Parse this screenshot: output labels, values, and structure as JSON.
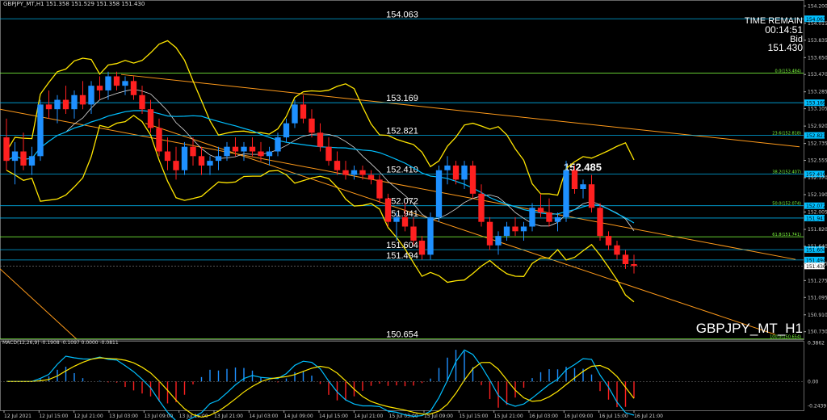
{
  "header": {
    "ohlc": "GBPJPY_MT,H1  151.358 151.529 151.358 151.430"
  },
  "time_remain": {
    "label": "TIME REMAIN",
    "value": "00:14:51",
    "bid_label": "Bid",
    "bid_value": "151.430"
  },
  "symbol_label": "GBPJPY_MT_H1",
  "colors": {
    "bull": "#1e90ff",
    "bear": "#ff2020",
    "level": "#7fff3f",
    "trend": "#ff9a1a",
    "band": "#ffe600",
    "cyan": "#00bfff"
  },
  "chart_data": {
    "type": "candlestick",
    "ylim": [
      150.65,
      154.22
    ],
    "price_ticks": [
      "154.200",
      "154.015",
      "153.835",
      "153.650",
      "153.470",
      "153.285",
      "153.105",
      "152.920",
      "152.735",
      "152.555",
      "152.370",
      "152.190",
      "152.005",
      "151.820",
      "151.640",
      "151.455",
      "151.275",
      "151.095",
      "150.910",
      "150.730"
    ],
    "x_ticks": [
      "12 Jul 2021",
      "12 Jul 15:00",
      "12 Jul 21:00",
      "13 Jul 03:00",
      "13 Jul 09:00",
      "13 Jul 15:00",
      "13 Jul 21:00",
      "14 Jul 03:00",
      "14 Jul 09:00",
      "14 Jul 15:00",
      "14 Jul 21:00",
      "15 Jul 03:00",
      "15 Jul 09:00",
      "15 Jul 15:00",
      "15 Jul 21:00",
      "16 Jul 03:00",
      "16 Jul 09:00",
      "16 Jul 15:00",
      "16 Jul 21:00"
    ],
    "levels": [
      {
        "value": 154.063,
        "label": "154.063",
        "tag": "154.063"
      },
      {
        "value": 153.484,
        "label": "",
        "tag": "",
        "fib": "0.0(153.484)"
      },
      {
        "value": 153.169,
        "label": "153.169",
        "tag": "153.169"
      },
      {
        "value": 152.821,
        "label": "152.821",
        "tag": "152.821",
        "fib": "23.6(152.818)"
      },
      {
        "value": 152.41,
        "label": "152.410",
        "tag": "152.410",
        "fib": "38.2(152.407)"
      },
      {
        "value": 152.072,
        "label": "152.072",
        "tag": "152.072",
        "fib": "50.0(152.074)"
      },
      {
        "value": 151.941,
        "label": "151.941",
        "tag": "151.941"
      },
      {
        "value": 151.741,
        "label": "",
        "tag": "",
        "fib": "61.8(151.741)"
      },
      {
        "value": 151.604,
        "label": "151.604",
        "tag": "151.604"
      },
      {
        "value": 151.494,
        "label": "151.494",
        "tag": "151.494"
      },
      {
        "value": 150.654,
        "label": "150.654",
        "tag": "",
        "fib": "100.0(150.654)"
      }
    ],
    "current_price": {
      "value": 151.43,
      "label": "151.430"
    },
    "annotation": "152.485",
    "candles": [
      [
        152.8,
        153.0,
        152.45,
        152.55
      ],
      [
        152.55,
        152.75,
        152.3,
        152.65
      ],
      [
        152.65,
        152.85,
        152.45,
        152.5
      ],
      [
        152.5,
        152.7,
        152.4,
        152.6
      ],
      [
        152.6,
        153.2,
        152.55,
        153.15
      ],
      [
        153.15,
        153.3,
        153.0,
        153.1
      ],
      [
        153.1,
        153.25,
        152.95,
        153.2
      ],
      [
        153.2,
        153.35,
        153.05,
        153.1
      ],
      [
        153.1,
        153.3,
        153.0,
        153.25
      ],
      [
        153.25,
        153.4,
        153.1,
        153.15
      ],
      [
        153.15,
        153.4,
        153.05,
        153.35
      ],
      [
        153.35,
        153.45,
        153.2,
        153.3
      ],
      [
        153.3,
        153.5,
        153.2,
        153.45
      ],
      [
        153.45,
        153.5,
        153.3,
        153.35
      ],
      [
        153.35,
        153.45,
        153.25,
        153.4
      ],
      [
        153.4,
        153.45,
        153.2,
        153.25
      ],
      [
        153.25,
        153.35,
        153.05,
        153.1
      ],
      [
        153.1,
        153.2,
        152.85,
        152.9
      ],
      [
        152.9,
        153.0,
        152.6,
        152.65
      ],
      [
        152.65,
        152.8,
        152.45,
        152.55
      ],
      [
        152.55,
        152.7,
        152.35,
        152.45
      ],
      [
        152.45,
        152.75,
        152.4,
        152.7
      ],
      [
        152.7,
        152.8,
        152.5,
        152.6
      ],
      [
        152.6,
        152.7,
        152.4,
        152.5
      ],
      [
        152.5,
        152.6,
        152.4,
        152.55
      ],
      [
        152.55,
        152.7,
        152.45,
        152.6
      ],
      [
        152.6,
        152.75,
        152.55,
        152.7
      ],
      [
        152.7,
        152.8,
        152.6,
        152.65
      ],
      [
        152.65,
        152.75,
        152.55,
        152.7
      ],
      [
        152.7,
        152.8,
        152.6,
        152.65
      ],
      [
        152.65,
        152.75,
        152.55,
        152.6
      ],
      [
        152.6,
        152.7,
        152.5,
        152.65
      ],
      [
        152.65,
        152.85,
        152.6,
        152.8
      ],
      [
        152.8,
        153.0,
        152.75,
        152.95
      ],
      [
        152.95,
        153.2,
        152.9,
        153.15
      ],
      [
        153.15,
        153.25,
        152.95,
        153.0
      ],
      [
        153.0,
        153.1,
        152.8,
        152.85
      ],
      [
        152.85,
        152.95,
        152.65,
        152.7
      ],
      [
        152.7,
        152.8,
        152.5,
        152.55
      ],
      [
        152.55,
        152.65,
        152.4,
        152.45
      ],
      [
        152.45,
        152.55,
        152.35,
        152.4
      ],
      [
        152.4,
        152.5,
        152.35,
        152.45
      ],
      [
        152.45,
        152.5,
        152.35,
        152.4
      ],
      [
        152.4,
        152.45,
        152.3,
        152.35
      ],
      [
        152.35,
        152.4,
        152.1,
        152.15
      ],
      [
        152.15,
        152.2,
        151.85,
        151.9
      ],
      [
        151.9,
        152.0,
        151.7,
        151.95
      ],
      [
        151.95,
        152.1,
        151.8,
        151.85
      ],
      [
        151.85,
        151.95,
        151.65,
        151.7
      ],
      [
        151.7,
        151.75,
        151.5,
        151.55
      ],
      [
        151.55,
        152.0,
        151.5,
        151.95
      ],
      [
        151.95,
        152.5,
        151.9,
        152.45
      ],
      [
        152.45,
        152.6,
        152.3,
        152.5
      ],
      [
        152.5,
        152.55,
        152.3,
        152.35
      ],
      [
        152.35,
        152.55,
        152.25,
        152.5
      ],
      [
        152.5,
        152.55,
        152.15,
        152.2
      ],
      [
        152.2,
        152.3,
        151.85,
        151.9
      ],
      [
        151.9,
        151.95,
        151.6,
        151.65
      ],
      [
        151.65,
        151.8,
        151.55,
        151.75
      ],
      [
        151.75,
        151.9,
        151.7,
        151.85
      ],
      [
        151.85,
        151.95,
        151.75,
        151.8
      ],
      [
        151.8,
        151.9,
        151.7,
        151.85
      ],
      [
        151.85,
        152.1,
        151.8,
        152.05
      ],
      [
        152.05,
        152.2,
        151.95,
        152.0
      ],
      [
        152.0,
        152.15,
        151.85,
        151.9
      ],
      [
        151.9,
        152.0,
        151.8,
        151.95
      ],
      [
        151.95,
        152.55,
        151.9,
        152.45
      ],
      [
        152.45,
        152.5,
        152.2,
        152.25
      ],
      [
        152.25,
        152.35,
        152.15,
        152.3
      ],
      [
        152.3,
        152.4,
        152.0,
        152.05
      ],
      [
        152.05,
        152.1,
        151.7,
        151.75
      ],
      [
        151.75,
        151.8,
        151.6,
        151.65
      ],
      [
        151.65,
        151.7,
        151.5,
        151.55
      ],
      [
        151.55,
        151.6,
        151.4,
        151.45
      ],
      [
        151.45,
        151.55,
        151.35,
        151.43
      ]
    ],
    "macd": {
      "label": "MACD(12,26,9) -0.1908 -0.1097 0.0000 -0.0811",
      "ylim": [
        -0.28,
        0.39
      ],
      "ticks": [
        "0.3862",
        "0.00",
        "-0.2439"
      ]
    }
  }
}
